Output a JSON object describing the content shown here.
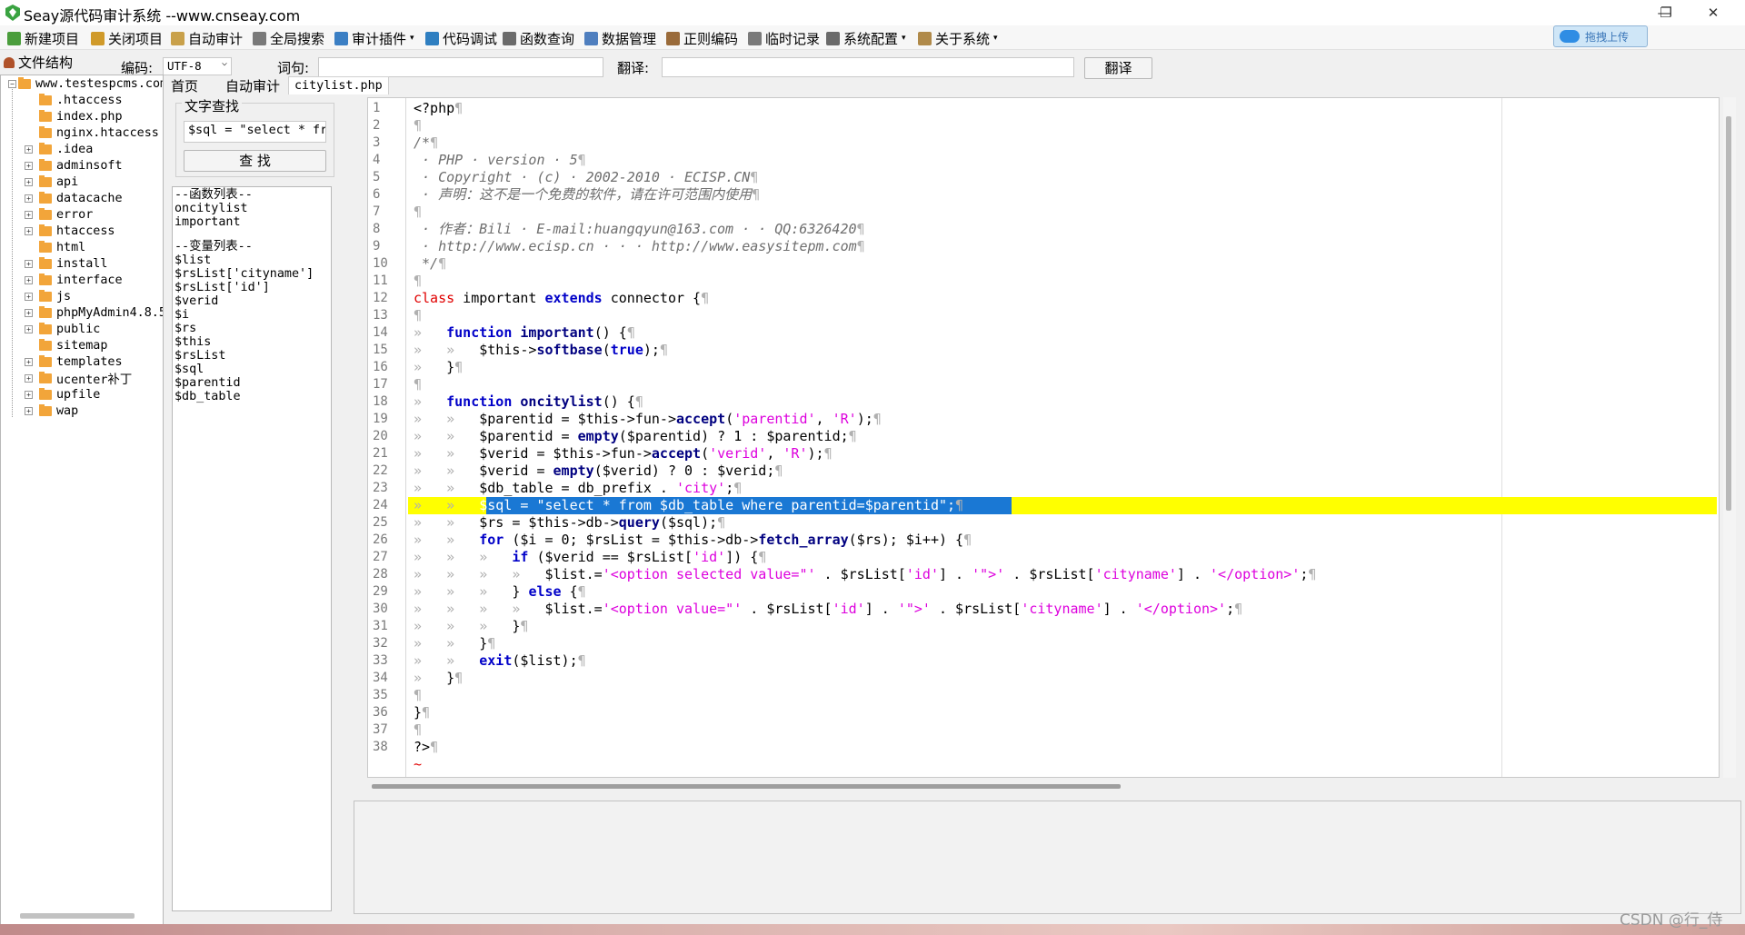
{
  "window": {
    "title": "Seay源代码审计系统 --www.cnseay.com",
    "buttons": [
      "—",
      "❐",
      "✕"
    ]
  },
  "toolbar": {
    "items": [
      {
        "label": "新建项目",
        "icon": "new-project-icon",
        "color": "#4a9d3c"
      },
      {
        "label": "关闭项目",
        "icon": "close-project-icon",
        "color": "#d09a2a"
      },
      {
        "label": "自动审计",
        "icon": "auto-audit-icon",
        "color": "#c9a14b"
      },
      {
        "label": "全局搜索",
        "icon": "global-search-icon",
        "color": "#7a7a7a"
      },
      {
        "label": "审计插件",
        "icon": "plugin-icon",
        "color": "#3b7fc4",
        "dropdown": true
      },
      {
        "label": "代码调试",
        "icon": "debug-icon",
        "color": "#2f7fc1"
      },
      {
        "label": "函数查询",
        "icon": "function-query-icon",
        "color": "#6b6b6b"
      },
      {
        "label": "数据管理",
        "icon": "data-manage-icon",
        "color": "#4f7fbf"
      },
      {
        "label": "正则编码",
        "icon": "regex-icon",
        "color": "#9a6b3a"
      },
      {
        "label": "临时记录",
        "icon": "temp-record-icon",
        "color": "#7a7a7a"
      },
      {
        "label": "系统配置",
        "icon": "gear-icon",
        "color": "#6a6a6a",
        "dropdown": true
      },
      {
        "label": "关于系统",
        "icon": "about-icon",
        "color": "#b08a4a",
        "dropdown": true
      }
    ],
    "upload_label": "拖拽上传"
  },
  "tree": {
    "title": "文件结构",
    "root": "www.testespcms.com",
    "items": [
      {
        "label": ".htaccess",
        "expandable": false
      },
      {
        "label": "index.php",
        "expandable": false
      },
      {
        "label": "nginx.htaccess",
        "expandable": false
      },
      {
        "label": ".idea",
        "expandable": true
      },
      {
        "label": "adminsoft",
        "expandable": true
      },
      {
        "label": "api",
        "expandable": true
      },
      {
        "label": "datacache",
        "expandable": true
      },
      {
        "label": "error",
        "expandable": true
      },
      {
        "label": "htaccess",
        "expandable": true
      },
      {
        "label": "html",
        "expandable": false
      },
      {
        "label": "install",
        "expandable": true
      },
      {
        "label": "interface",
        "expandable": true
      },
      {
        "label": "js",
        "expandable": true
      },
      {
        "label": "phpMyAdmin4.8.5",
        "expandable": true
      },
      {
        "label": "public",
        "expandable": true
      },
      {
        "label": "sitemap",
        "expandable": false
      },
      {
        "label": "templates",
        "expandable": true
      },
      {
        "label": "ucenter补丁",
        "expandable": true
      },
      {
        "label": "upfile",
        "expandable": true
      },
      {
        "label": "wap",
        "expandable": true
      }
    ]
  },
  "row2": {
    "encoding_label": "编码:",
    "encoding_value": "UTF-8",
    "term_label": "词句:",
    "term_value": "",
    "translate_label": "翻译:",
    "translate_value": "",
    "translate_button": "翻译"
  },
  "tabs": [
    {
      "label": "首页",
      "active": false
    },
    {
      "label": "自动审计",
      "active": false
    },
    {
      "label": "citylist.php",
      "active": true
    }
  ],
  "find": {
    "legend": "文字查找",
    "input_value": "$sql = \"select * from",
    "button": "查 找"
  },
  "lists": {
    "functions_header": "--函数列表--",
    "functions": [
      "oncitylist",
      "important"
    ],
    "variables_header": "--变量列表--",
    "variables": [
      "$list",
      "$rsList['cityname']",
      "$rsList['id']",
      "$verid",
      "$i",
      "$rs",
      "$this",
      "$rsList",
      "$sql",
      "$parentid",
      "$db_table"
    ]
  },
  "editor": {
    "highlighted_line": 24,
    "end_marker": "~",
    "lines": [
      [
        [
          "<?php",
          "p"
        ],
        [
          "¶",
          "w"
        ]
      ],
      [
        [
          "¶",
          "w"
        ]
      ],
      [
        [
          "/*",
          "c"
        ],
        [
          "¶",
          "w"
        ]
      ],
      [
        [
          " · PHP · version · 5",
          "c"
        ],
        [
          "¶",
          "w"
        ]
      ],
      [
        [
          " · Copyright · (c) · 2002-2010 · ECISP.CN",
          "c"
        ],
        [
          "¶",
          "w"
        ]
      ],
      [
        [
          " · 声明：这不是一个免费的软件，请在许可范围内使用",
          "c"
        ],
        [
          "¶",
          "w"
        ]
      ],
      [
        [
          "¶",
          "w"
        ]
      ],
      [
        [
          " · 作者：Bili · E-mail:huangqyun@163.com · · QQ:6326420",
          "c"
        ],
        [
          "¶",
          "w"
        ]
      ],
      [
        [
          " · http://www.ecisp.cn · · · http://www.easysitepm.com",
          "c"
        ],
        [
          "¶",
          "w"
        ]
      ],
      [
        [
          " */",
          "c"
        ],
        [
          "¶",
          "w"
        ]
      ],
      [
        [
          "¶",
          "w"
        ]
      ],
      [
        [
          "class",
          "k2"
        ],
        [
          " important ",
          "p"
        ],
        [
          "extends",
          "k"
        ],
        [
          " connector {",
          "p"
        ],
        [
          "¶",
          "w"
        ]
      ],
      [
        [
          "¶",
          "w"
        ]
      ],
      [
        [
          "»   ",
          "w"
        ],
        [
          "function ",
          "k"
        ],
        [
          "important",
          "f"
        ],
        [
          "() {",
          "p"
        ],
        [
          "¶",
          "w"
        ]
      ],
      [
        [
          "»   »   ",
          "w"
        ],
        [
          "$this->",
          "p"
        ],
        [
          "softbase",
          "f"
        ],
        [
          "(",
          "p"
        ],
        [
          "true",
          "k"
        ],
        [
          ");",
          "p"
        ],
        [
          "¶",
          "w"
        ]
      ],
      [
        [
          "»   ",
          "w"
        ],
        [
          "}",
          "p"
        ],
        [
          "¶",
          "w"
        ]
      ],
      [
        [
          "¶",
          "w"
        ]
      ],
      [
        [
          "»   ",
          "w"
        ],
        [
          "function ",
          "k"
        ],
        [
          "oncitylist",
          "f"
        ],
        [
          "() {",
          "p"
        ],
        [
          "¶",
          "w"
        ]
      ],
      [
        [
          "»   »   ",
          "w"
        ],
        [
          "$parentid = $this->fun->",
          "p"
        ],
        [
          "accept",
          "f"
        ],
        [
          "(",
          "p"
        ],
        [
          "'parentid'",
          "s"
        ],
        [
          ", ",
          "p"
        ],
        [
          "'R'",
          "s"
        ],
        [
          ");",
          "p"
        ],
        [
          "¶",
          "w"
        ]
      ],
      [
        [
          "»   »   ",
          "w"
        ],
        [
          "$parentid = ",
          "p"
        ],
        [
          "empty",
          "f"
        ],
        [
          "($parentid) ? 1 : $parentid;",
          "p"
        ],
        [
          "¶",
          "w"
        ]
      ],
      [
        [
          "»   »   ",
          "w"
        ],
        [
          "$verid = $this->fun->",
          "p"
        ],
        [
          "accept",
          "f"
        ],
        [
          "(",
          "p"
        ],
        [
          "'verid'",
          "s"
        ],
        [
          ", ",
          "p"
        ],
        [
          "'R'",
          "s"
        ],
        [
          ");",
          "p"
        ],
        [
          "¶",
          "w"
        ]
      ],
      [
        [
          "»   »   ",
          "w"
        ],
        [
          "$verid = ",
          "p"
        ],
        [
          "empty",
          "f"
        ],
        [
          "($verid) ? 0 : $verid;",
          "p"
        ],
        [
          "¶",
          "w"
        ]
      ],
      [
        [
          "»   »   ",
          "w"
        ],
        [
          "$db_table = db_prefix . ",
          "p"
        ],
        [
          "'city'",
          "s"
        ],
        [
          ";",
          "p"
        ],
        [
          "¶",
          "w"
        ]
      ],
      [
        [
          "»   »   ",
          "w"
        ],
        [
          "$sql = \"select * from $db_table where parentid=$parentid\";",
          "h"
        ],
        [
          "¶",
          "w"
        ]
      ],
      [
        [
          "»   »   ",
          "w"
        ],
        [
          "$rs = $this->db->",
          "p"
        ],
        [
          "query",
          "f"
        ],
        [
          "($sql);",
          "p"
        ],
        [
          "¶",
          "w"
        ]
      ],
      [
        [
          "»   »   ",
          "w"
        ],
        [
          "for",
          "k"
        ],
        [
          " ($i = 0; $rsList = $this->db->",
          "p"
        ],
        [
          "fetch_array",
          "f"
        ],
        [
          "($rs); $i++) {",
          "p"
        ],
        [
          "¶",
          "w"
        ]
      ],
      [
        [
          "»   »   »   ",
          "w"
        ],
        [
          "if",
          "k"
        ],
        [
          " ($verid == $rsList[",
          "p"
        ],
        [
          "'id'",
          "s"
        ],
        [
          "]) {",
          "p"
        ],
        [
          "¶",
          "w"
        ]
      ],
      [
        [
          "»   »   »   »   ",
          "w"
        ],
        [
          "$list.=",
          "p"
        ],
        [
          "'<option selected value=\"'",
          "s"
        ],
        [
          " . $rsList[",
          "p"
        ],
        [
          "'id'",
          "s"
        ],
        [
          "] . ",
          "p"
        ],
        [
          "'\">'",
          "s"
        ],
        [
          " . $rsList[",
          "p"
        ],
        [
          "'cityname'",
          "s"
        ],
        [
          "] . ",
          "p"
        ],
        [
          "'</option>'",
          "s"
        ],
        [
          ";",
          "p"
        ],
        [
          "¶",
          "w"
        ]
      ],
      [
        [
          "»   »   »   ",
          "w"
        ],
        [
          "} ",
          "p"
        ],
        [
          "else",
          "k"
        ],
        [
          " {",
          "p"
        ],
        [
          "¶",
          "w"
        ]
      ],
      [
        [
          "»   »   »   »   ",
          "w"
        ],
        [
          "$list.=",
          "p"
        ],
        [
          "'<option value=\"'",
          "s"
        ],
        [
          " . $rsList[",
          "p"
        ],
        [
          "'id'",
          "s"
        ],
        [
          "] . ",
          "p"
        ],
        [
          "'\">'",
          "s"
        ],
        [
          " . $rsList[",
          "p"
        ],
        [
          "'cityname'",
          "s"
        ],
        [
          "] . ",
          "p"
        ],
        [
          "'</option>'",
          "s"
        ],
        [
          ";",
          "p"
        ],
        [
          "¶",
          "w"
        ]
      ],
      [
        [
          "»   »   »   ",
          "w"
        ],
        [
          "}",
          "p"
        ],
        [
          "¶",
          "w"
        ]
      ],
      [
        [
          "»   »   ",
          "w"
        ],
        [
          "}",
          "p"
        ],
        [
          "¶",
          "w"
        ]
      ],
      [
        [
          "»   »   ",
          "w"
        ],
        [
          "exit",
          "k"
        ],
        [
          "($list);",
          "p"
        ],
        [
          "¶",
          "w"
        ]
      ],
      [
        [
          "»   ",
          "w"
        ],
        [
          "}",
          "p"
        ],
        [
          "¶",
          "w"
        ]
      ],
      [
        [
          "¶",
          "w"
        ]
      ],
      [
        [
          "}",
          "p"
        ],
        [
          "¶",
          "w"
        ]
      ],
      [
        [
          "¶",
          "w"
        ]
      ],
      [
        [
          "?>",
          "p"
        ],
        [
          "¶",
          "w"
        ]
      ]
    ]
  },
  "watermark": "CSDN @行_侍"
}
